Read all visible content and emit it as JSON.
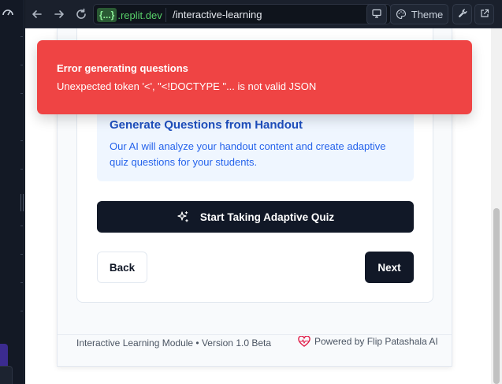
{
  "browser": {
    "url_brackets": "{...}",
    "url_domain": ".replit.dev",
    "url_path": "/interactive-learning",
    "theme_label": "Theme"
  },
  "card": {
    "info_title": "Generate Questions from Handout",
    "info_text": "Our AI will analyze your handout content and create adaptive quiz questions for your students.",
    "start_label": "Start Taking Adaptive Quiz",
    "back_label": "Back",
    "next_label": "Next"
  },
  "footer": {
    "left_text": "Interactive Learning Module • Version 1.0 Beta",
    "right_text": "Powered by Flip Patashala AI"
  },
  "toast": {
    "title": "Error generating questions",
    "message": "Unexpected token '<', \"<!DOCTYPE \"... is not valid JSON"
  },
  "colors": {
    "toast_bg": "#ef4444",
    "primary_button": "#111827",
    "info_bg": "#eff6ff",
    "info_text": "#2563eb",
    "url_domain": "#58d16a"
  },
  "icons": {
    "gauge": "gauge-icon",
    "back": "arrow-left-icon",
    "forward": "arrow-right-icon",
    "reload": "reload-icon",
    "go": "arrow-right-small-icon",
    "device": "monitor-icon",
    "theme": "palette-icon",
    "devtools": "wrench-icon",
    "open_new": "external-link-icon",
    "sparkles": "sparkles-icon",
    "heart": "heart-pulse-icon"
  }
}
